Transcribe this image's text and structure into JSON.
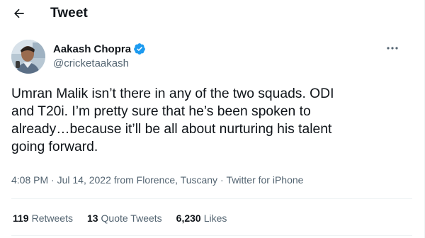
{
  "header": {
    "title": "Tweet",
    "back_icon": "back-arrow-icon"
  },
  "author": {
    "display_name": "Aakash Chopra",
    "handle": "@cricketaakash",
    "verified": true,
    "verified_color": "#1d9bf0"
  },
  "tweet": {
    "text": "Umran Malik isn’t there in any of the two squads. ODI\nand T20i. I’m pretty sure that he’s been spoken to\nalready…because it’ll be all about nurturing his talent\ngoing forward."
  },
  "meta": {
    "time": "4:08 PM",
    "separator": " · ",
    "date": "Jul 14, 2022",
    "location": "from Florence, Tuscany",
    "client": "Twitter for iPhone"
  },
  "stats": {
    "retweets_count": "119",
    "retweets_label": "Retweets",
    "quote_count": "13",
    "quote_label": "Quote Tweets",
    "likes_count": "6,230",
    "likes_label": "Likes"
  },
  "colors": {
    "text_primary": "#0f1419",
    "text_secondary": "#536471",
    "divider": "#eff3f4",
    "accent": "#1d9bf0"
  }
}
